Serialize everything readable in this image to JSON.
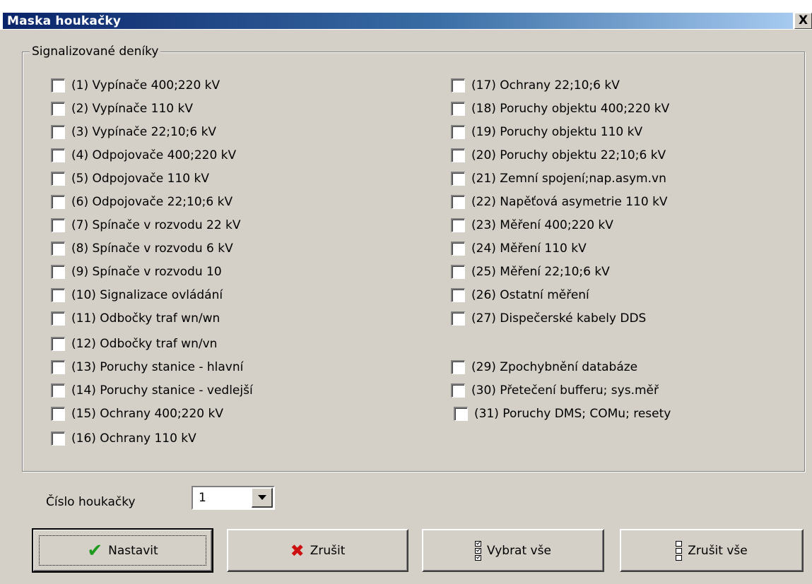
{
  "window": {
    "title": "Maska houkačky",
    "close_label": "X"
  },
  "group": {
    "legend": "Signalizované deníky"
  },
  "checkboxes_left": [
    {
      "label": "(1)  Vypínače 400;220 kV",
      "checked": false
    },
    {
      "label": "(2)  Vypínače 110 kV",
      "checked": false
    },
    {
      "label": "(3)  Vypínače 22;10;6 kV",
      "checked": false
    },
    {
      "label": "(4)  Odpojovače 400;220 kV",
      "checked": false
    },
    {
      "label": "(5)  Odpojovače 110 kV",
      "checked": false
    },
    {
      "label": "(6)  Odpojovače 22;10;6 kV",
      "checked": false
    },
    {
      "label": "(7)  Spínače v rozvodu 22 kV",
      "checked": false
    },
    {
      "label": "(8)  Spínače v rozvodu 6 kV",
      "checked": false
    },
    {
      "label": "(9)  Spínače v rozvodu 10",
      "checked": false
    },
    {
      "label": "(10) Signalizace ovládání",
      "checked": false
    },
    {
      "label": "(11) Odbočky traf wn/wn",
      "checked": false
    },
    {
      "label": "(12) Odbočky traf wn/vn",
      "checked": false
    },
    {
      "label": "(13) Poruchy stanice - hlavní",
      "checked": false
    },
    {
      "label": "(14) Poruchy stanice - vedlejší",
      "checked": false
    },
    {
      "label": "(15) Ochrany 400;220 kV",
      "checked": false
    },
    {
      "label": "(16) Ochrany 110 kV",
      "checked": false
    }
  ],
  "checkboxes_right": [
    {
      "label": "(17) Ochrany 22;10;6 kV",
      "checked": false
    },
    {
      "label": "(18) Poruchy objektu 400;220 kV",
      "checked": false
    },
    {
      "label": "(19) Poruchy objektu 110 kV",
      "checked": false
    },
    {
      "label": "(20) Poruchy objektu 22;10;6 kV",
      "checked": false
    },
    {
      "label": "(21) Zemní spojení;nap.asym.vn",
      "checked": false
    },
    {
      "label": "(22) Napěťová asymetrie 110 kV",
      "checked": false
    },
    {
      "label": "(23) Měření 400;220 kV",
      "checked": false
    },
    {
      "label": "(24) Měření 110 kV",
      "checked": false
    },
    {
      "label": "(25) Měření 22;10;6 kV",
      "checked": false
    },
    {
      "label": "(26) Ostatní měření",
      "checked": false
    },
    {
      "label": "(27) Dispečerské kabely DDS",
      "checked": false
    },
    {
      "label": "(29) Zpochybnění databáze",
      "checked": false
    },
    {
      "label": "(30) Přetečení bufferu; sys.měř",
      "checked": false
    },
    {
      "label": "(31) Poruchy DMS; COMu; resety",
      "checked": false
    }
  ],
  "siren": {
    "label": "Číslo houkačky",
    "value": "1"
  },
  "buttons": {
    "set": "Nastavit",
    "cancel": "Zrušit",
    "select_all": "Vybrat vše",
    "clear_all": "Zrušit vše"
  },
  "colors": {
    "dialog_bg": "#d4d0c8",
    "title_start": "#0a246a",
    "title_end": "#a6caf0",
    "check_icon": "#1f9a1f",
    "x_icon": "#cc1010"
  },
  "icons": {
    "set": "check-icon",
    "cancel": "x-icon",
    "select_all": "checklist-checked-icon",
    "clear_all": "checklist-empty-icon"
  }
}
